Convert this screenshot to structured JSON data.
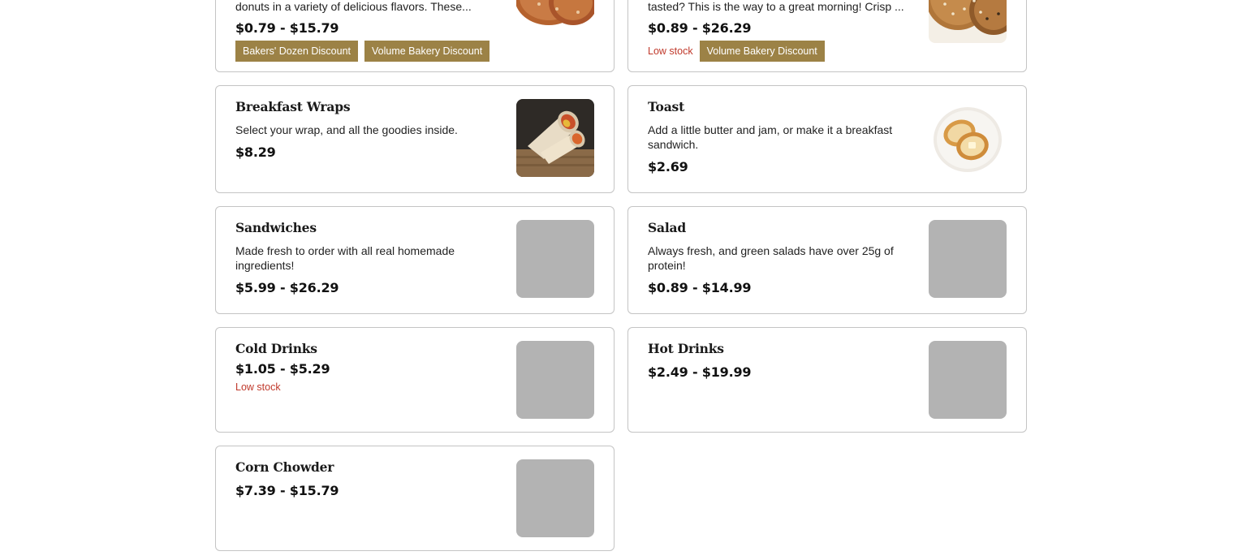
{
  "products": {
    "donuts": {
      "description": "donuts in a variety of delicious flavors. These...",
      "price": "$0.79 - $15.79",
      "tags": [
        "Bakers' Dozen Discount",
        "Volume Bakery Discount"
      ],
      "image": "donuts-photo"
    },
    "bagels": {
      "description": "tasted? This is the way to a great morning! Crisp ...",
      "price": "$0.89 - $26.29",
      "stock": "Low stock",
      "tags": [
        "Volume Bakery Discount"
      ],
      "image": "bagels-photo"
    },
    "breakfast_wraps": {
      "title": "Breakfast Wraps",
      "description": "Select your wrap, and all the goodies inside.",
      "price": "$8.29",
      "image": "wrap-photo"
    },
    "toast": {
      "title": "Toast",
      "description": "Add a little butter and jam, or make it a breakfast sandwich.",
      "price": "$2.69",
      "image": "toast-photo"
    },
    "sandwiches": {
      "title": "Sandwiches",
      "description": "Made fresh to order with all real homemade ingredients!",
      "price": "$5.99 - $26.29",
      "image": "placeholder"
    },
    "salad": {
      "title": "Salad",
      "description": "Always fresh, and green salads have over 25g of protein!",
      "price": "$0.89 - $14.99",
      "image": "placeholder"
    },
    "cold_drinks": {
      "title": "Cold Drinks",
      "price": "$1.05 - $5.29",
      "stock": "Low stock",
      "image": "placeholder"
    },
    "hot_drinks": {
      "title": "Hot Drinks",
      "price": "$2.49 - $19.99",
      "image": "placeholder"
    },
    "corn_chowder": {
      "title": "Corn Chowder",
      "price": "$7.39 - $15.79",
      "image": "placeholder"
    }
  },
  "colors": {
    "tag_background": "#9c8246",
    "low_stock": "#c0392b",
    "placeholder": "#b3b3b3",
    "card_border": "#c4c4c4"
  }
}
